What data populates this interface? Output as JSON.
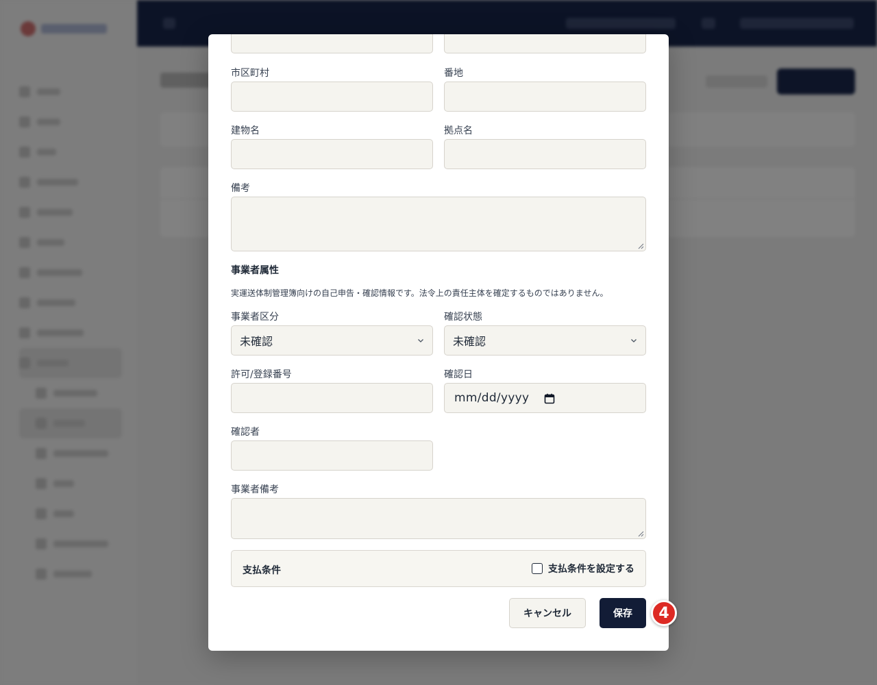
{
  "modal": {
    "address": {
      "city_label": "市区町村",
      "city_value": "",
      "street_label": "番地",
      "street_value": "",
      "building_label": "建物名",
      "building_value": "",
      "base_label": "拠点名",
      "base_value": ""
    },
    "notes": {
      "label": "備考",
      "value": ""
    },
    "operator_attributes": {
      "title": "事業者属性",
      "description": "実運送体制管理簿向けの自己申告・確認情報です。法令上の責任主体を確定するものではありません。",
      "category_label": "事業者区分",
      "category_value": "未確認",
      "status_label": "確認状態",
      "status_value": "未確認",
      "license_label": "許可/登録番号",
      "license_value": "",
      "confirm_date_label": "確認日",
      "confirm_date_placeholder": "mm/dd/yyyy",
      "confirmer_label": "確認者",
      "confirmer_value": "",
      "operator_notes_label": "事業者備考",
      "operator_notes_value": ""
    },
    "payment": {
      "title": "支払条件",
      "checkbox_label": "支払条件を設定する",
      "checked": false
    },
    "actions": {
      "cancel_label": "キャンセル",
      "save_label": "保存"
    }
  },
  "annotation": {
    "step_marker": "4"
  },
  "colors": {
    "input_bg": "#f5f4ef",
    "primary": "#121c36",
    "marker": "#dd2a24",
    "topbar": "#0c1326"
  }
}
